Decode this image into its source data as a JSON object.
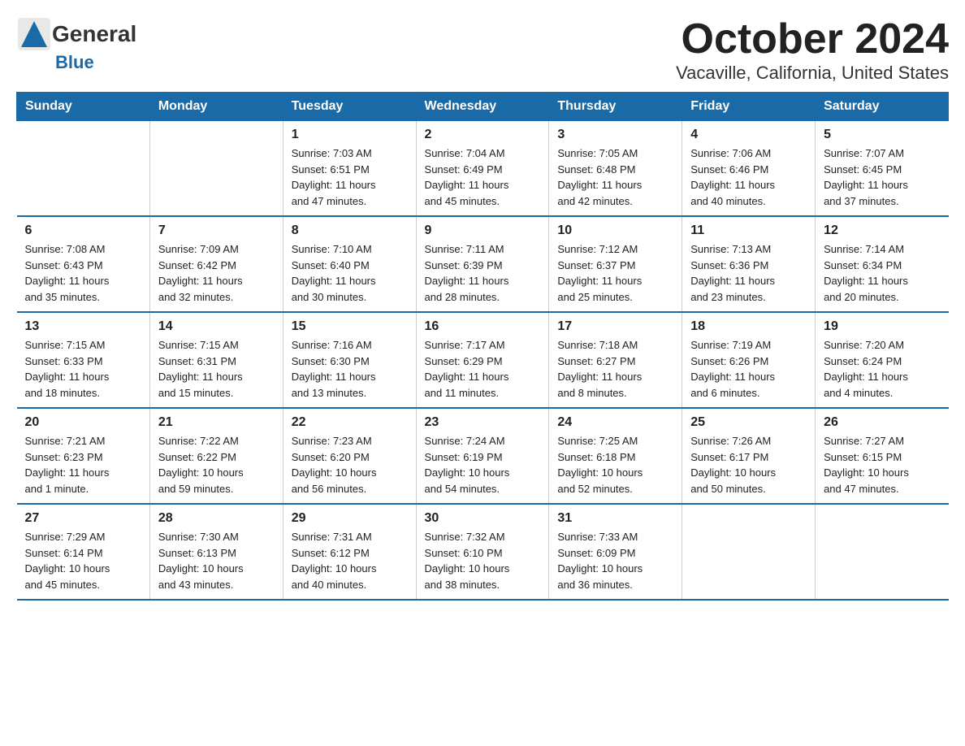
{
  "logo": {
    "general": "General",
    "blue": "Blue"
  },
  "title": "October 2024",
  "subtitle": "Vacaville, California, United States",
  "days": [
    "Sunday",
    "Monday",
    "Tuesday",
    "Wednesday",
    "Thursday",
    "Friday",
    "Saturday"
  ],
  "weeks": [
    [
      {
        "num": "",
        "info": ""
      },
      {
        "num": "",
        "info": ""
      },
      {
        "num": "1",
        "info": "Sunrise: 7:03 AM\nSunset: 6:51 PM\nDaylight: 11 hours\nand 47 minutes."
      },
      {
        "num": "2",
        "info": "Sunrise: 7:04 AM\nSunset: 6:49 PM\nDaylight: 11 hours\nand 45 minutes."
      },
      {
        "num": "3",
        "info": "Sunrise: 7:05 AM\nSunset: 6:48 PM\nDaylight: 11 hours\nand 42 minutes."
      },
      {
        "num": "4",
        "info": "Sunrise: 7:06 AM\nSunset: 6:46 PM\nDaylight: 11 hours\nand 40 minutes."
      },
      {
        "num": "5",
        "info": "Sunrise: 7:07 AM\nSunset: 6:45 PM\nDaylight: 11 hours\nand 37 minutes."
      }
    ],
    [
      {
        "num": "6",
        "info": "Sunrise: 7:08 AM\nSunset: 6:43 PM\nDaylight: 11 hours\nand 35 minutes."
      },
      {
        "num": "7",
        "info": "Sunrise: 7:09 AM\nSunset: 6:42 PM\nDaylight: 11 hours\nand 32 minutes."
      },
      {
        "num": "8",
        "info": "Sunrise: 7:10 AM\nSunset: 6:40 PM\nDaylight: 11 hours\nand 30 minutes."
      },
      {
        "num": "9",
        "info": "Sunrise: 7:11 AM\nSunset: 6:39 PM\nDaylight: 11 hours\nand 28 minutes."
      },
      {
        "num": "10",
        "info": "Sunrise: 7:12 AM\nSunset: 6:37 PM\nDaylight: 11 hours\nand 25 minutes."
      },
      {
        "num": "11",
        "info": "Sunrise: 7:13 AM\nSunset: 6:36 PM\nDaylight: 11 hours\nand 23 minutes."
      },
      {
        "num": "12",
        "info": "Sunrise: 7:14 AM\nSunset: 6:34 PM\nDaylight: 11 hours\nand 20 minutes."
      }
    ],
    [
      {
        "num": "13",
        "info": "Sunrise: 7:15 AM\nSunset: 6:33 PM\nDaylight: 11 hours\nand 18 minutes."
      },
      {
        "num": "14",
        "info": "Sunrise: 7:15 AM\nSunset: 6:31 PM\nDaylight: 11 hours\nand 15 minutes."
      },
      {
        "num": "15",
        "info": "Sunrise: 7:16 AM\nSunset: 6:30 PM\nDaylight: 11 hours\nand 13 minutes."
      },
      {
        "num": "16",
        "info": "Sunrise: 7:17 AM\nSunset: 6:29 PM\nDaylight: 11 hours\nand 11 minutes."
      },
      {
        "num": "17",
        "info": "Sunrise: 7:18 AM\nSunset: 6:27 PM\nDaylight: 11 hours\nand 8 minutes."
      },
      {
        "num": "18",
        "info": "Sunrise: 7:19 AM\nSunset: 6:26 PM\nDaylight: 11 hours\nand 6 minutes."
      },
      {
        "num": "19",
        "info": "Sunrise: 7:20 AM\nSunset: 6:24 PM\nDaylight: 11 hours\nand 4 minutes."
      }
    ],
    [
      {
        "num": "20",
        "info": "Sunrise: 7:21 AM\nSunset: 6:23 PM\nDaylight: 11 hours\nand 1 minute."
      },
      {
        "num": "21",
        "info": "Sunrise: 7:22 AM\nSunset: 6:22 PM\nDaylight: 10 hours\nand 59 minutes."
      },
      {
        "num": "22",
        "info": "Sunrise: 7:23 AM\nSunset: 6:20 PM\nDaylight: 10 hours\nand 56 minutes."
      },
      {
        "num": "23",
        "info": "Sunrise: 7:24 AM\nSunset: 6:19 PM\nDaylight: 10 hours\nand 54 minutes."
      },
      {
        "num": "24",
        "info": "Sunrise: 7:25 AM\nSunset: 6:18 PM\nDaylight: 10 hours\nand 52 minutes."
      },
      {
        "num": "25",
        "info": "Sunrise: 7:26 AM\nSunset: 6:17 PM\nDaylight: 10 hours\nand 50 minutes."
      },
      {
        "num": "26",
        "info": "Sunrise: 7:27 AM\nSunset: 6:15 PM\nDaylight: 10 hours\nand 47 minutes."
      }
    ],
    [
      {
        "num": "27",
        "info": "Sunrise: 7:29 AM\nSunset: 6:14 PM\nDaylight: 10 hours\nand 45 minutes."
      },
      {
        "num": "28",
        "info": "Sunrise: 7:30 AM\nSunset: 6:13 PM\nDaylight: 10 hours\nand 43 minutes."
      },
      {
        "num": "29",
        "info": "Sunrise: 7:31 AM\nSunset: 6:12 PM\nDaylight: 10 hours\nand 40 minutes."
      },
      {
        "num": "30",
        "info": "Sunrise: 7:32 AM\nSunset: 6:10 PM\nDaylight: 10 hours\nand 38 minutes."
      },
      {
        "num": "31",
        "info": "Sunrise: 7:33 AM\nSunset: 6:09 PM\nDaylight: 10 hours\nand 36 minutes."
      },
      {
        "num": "",
        "info": ""
      },
      {
        "num": "",
        "info": ""
      }
    ]
  ]
}
